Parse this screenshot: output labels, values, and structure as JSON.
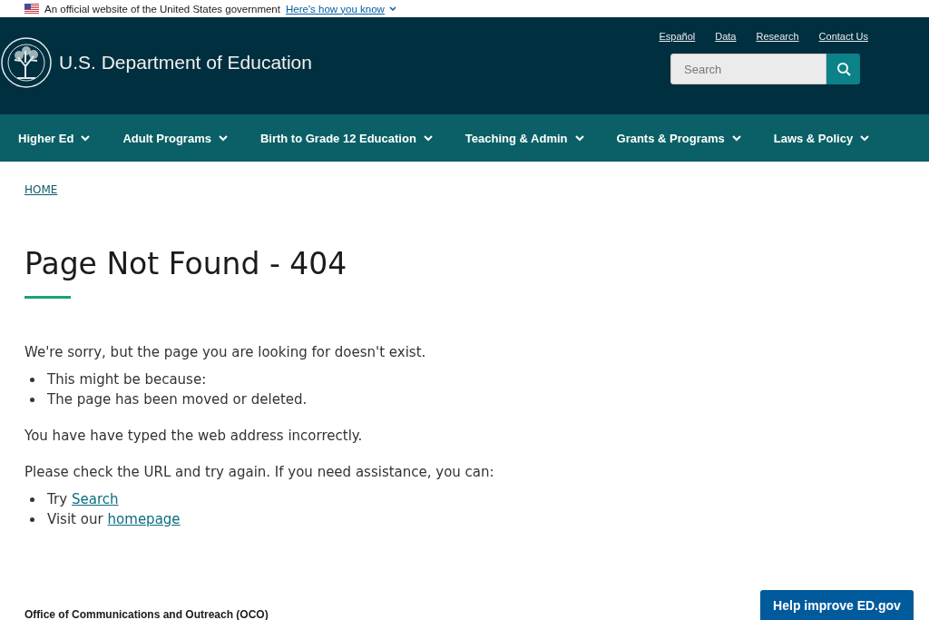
{
  "gov_banner": {
    "text": "An official website of the United States government",
    "link": "Here's how you know"
  },
  "header": {
    "site_title": "U.S. Department of Education",
    "utility_links": [
      "Español",
      "Data",
      "Research",
      "Contact Us"
    ],
    "search": {
      "placeholder": "Search"
    }
  },
  "nav": [
    "Higher Ed",
    "Adult Programs",
    "Birth to Grade 12 Education",
    "Teaching & Admin",
    "Grants & Programs",
    "Laws & Policy"
  ],
  "breadcrumb": [
    "HOME"
  ],
  "page_title": "Page Not Found - 404",
  "content": [
    {
      "kind": "paragraph",
      "text": "We're sorry, but the page you are looking for doesn't exist."
    },
    {
      "kind": "list",
      "items": [
        {
          "text": "This might be because:"
        },
        {
          "text": "The page has been moved or deleted."
        }
      ]
    },
    {
      "kind": "paragraph",
      "text": "You have have typed the web address incorrectly."
    },
    {
      "kind": "paragraph",
      "text": "Please check the URL and try again. If you need assistance, you can:"
    },
    {
      "kind": "list",
      "items": [
        {
          "text": "Try ",
          "link": "Search"
        },
        {
          "text": "Visit our ",
          "link": "homepage"
        }
      ]
    }
  ],
  "footer": {
    "office": "Office of Communications and Outreach (OCO)"
  },
  "feedback_button": "Help improve ED.gov"
}
